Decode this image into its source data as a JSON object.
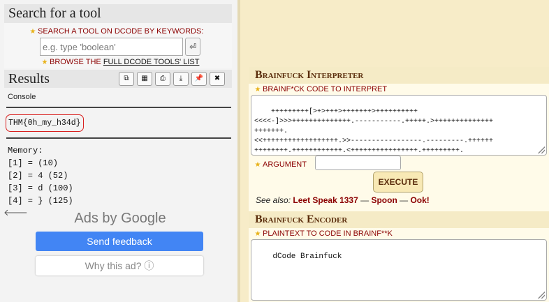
{
  "search": {
    "title": "Search for a tool",
    "keywords_label": "SEARCH A TOOL ON DCODE BY KEYWORDS:",
    "placeholder": "e.g. type 'boolean'",
    "go_glyph": "⏎",
    "browse_prefix": "BROWSE THE",
    "browse_link": "FULL DCODE TOOLS' LIST"
  },
  "results": {
    "title": "Results",
    "tool_buttons": [
      {
        "name": "copy-icon",
        "glyph": "⧉"
      },
      {
        "name": "calculator-icon",
        "glyph": "▦"
      },
      {
        "name": "print-icon",
        "glyph": "⎙"
      },
      {
        "name": "download-icon",
        "glyph": "⤓"
      },
      {
        "name": "pin-icon",
        "glyph": "📌"
      },
      {
        "name": "close-icon",
        "glyph": "✖"
      }
    ],
    "console_label": "Console",
    "flag": "THM{0h_my_h34d}",
    "memory_lines": [
      "Memory:",
      "[1] = (10)",
      "[2] = 4 (52)",
      "[3] = d (100)",
      "[4] = } (125)"
    ]
  },
  "ads": {
    "ads_by": "Ads by Google",
    "send_feedback": "Send feedback",
    "why_ad": "Why this ad? ⓘ"
  },
  "interpreter": {
    "title": "Brainfuck Interpreter",
    "code_label": "BRAINF*CK CODE TO INTERPRET",
    "code": "+++++++++[>+>+++>+++++++>++++++++++\n<<<<-]>>>++++++++++++++.-----------.+++++.>++++++++++++++\n+++++++.\n<<++++++++++++++++++.>>-----------------.---------.++++++\n++++++++.++++++++++++.<++++++++++++++++.+++++++++.\n<+++.+.>----.>++++.",
    "argument_label": "ARGUMENT",
    "execute_label": "EXECUTE",
    "see_also_label": "See also:",
    "see_also_links": [
      "Leet Speak 1337",
      "Spoon",
      "Ook!"
    ]
  },
  "encoder": {
    "title": "Brainfuck Encoder",
    "plaintext_label": "PLAINTEXT TO CODE IN BRAINF**K",
    "plaintext_value": "dCode Brainfuck"
  }
}
